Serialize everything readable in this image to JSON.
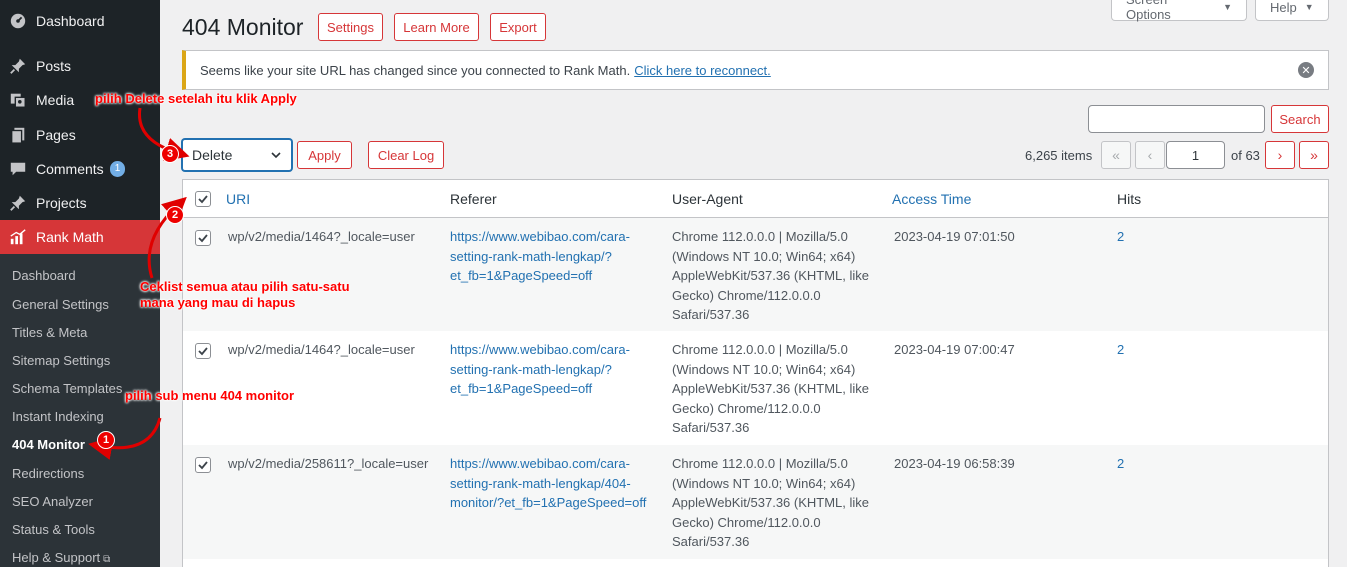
{
  "sidebar": {
    "top_items": [
      {
        "label": "Dashboard",
        "icon": "dashboard-icon"
      },
      {
        "label": "Posts",
        "icon": "pin-icon"
      },
      {
        "label": "Media",
        "icon": "media-icon"
      },
      {
        "label": "Pages",
        "icon": "pages-icon"
      },
      {
        "label": "Comments",
        "icon": "comment-icon",
        "badge": "1"
      },
      {
        "label": "Projects",
        "icon": "pin-icon"
      },
      {
        "label": "Rank Math",
        "icon": "chart-icon"
      }
    ],
    "sub_items": [
      {
        "label": "Dashboard"
      },
      {
        "label": "General Settings"
      },
      {
        "label": "Titles & Meta"
      },
      {
        "label": "Sitemap Settings"
      },
      {
        "label": "Schema Templates"
      },
      {
        "label": "Instant Indexing"
      },
      {
        "label": "404 Monitor"
      },
      {
        "label": "Redirections"
      },
      {
        "label": "SEO Analyzer"
      },
      {
        "label": "Status & Tools"
      },
      {
        "label": "Help & Support"
      }
    ]
  },
  "header": {
    "title": "404 Monitor",
    "buttons": {
      "settings": "Settings",
      "learn_more": "Learn More",
      "export": "Export"
    },
    "screen_options": "Screen Options",
    "help": "Help"
  },
  "notice": {
    "text": "Seems like your site URL has changed since you connected to Rank Math.",
    "link": "Click here to reconnect."
  },
  "toolbar": {
    "search_button": "Search",
    "bulk_action": "Delete",
    "apply": "Apply",
    "clear_log": "Clear Log",
    "items_count": "6,265 items",
    "first": "«",
    "prev": "‹",
    "current_page": "1",
    "of_pages": "of 63",
    "next": "›",
    "last": "»"
  },
  "table": {
    "headers": {
      "uri": "URI",
      "referer": "Referer",
      "user_agent": "User-Agent",
      "access_time": "Access Time",
      "hits": "Hits"
    },
    "rows": [
      {
        "uri": "wp/v2/media/1464?_locale=user",
        "referer": [
          "https://www.webibao.com/cara-",
          "setting-rank-math-lengkap/?",
          "et_fb=1&PageSpeed=off"
        ],
        "user_agent": [
          "Chrome 112.0.0.0 | Mozilla/5.0",
          "(Windows NT 10.0; Win64; x64)",
          "AppleWebKit/537.36 (KHTML, like",
          "Gecko) Chrome/112.0.0.0",
          "Safari/537.36"
        ],
        "access_time": "2023-04-19 07:01:50",
        "hits": "2"
      },
      {
        "uri": "wp/v2/media/1464?_locale=user",
        "referer": [
          "https://www.webibao.com/cara-",
          "setting-rank-math-lengkap/?",
          "et_fb=1&PageSpeed=off"
        ],
        "user_agent": [
          "Chrome 112.0.0.0 | Mozilla/5.0",
          "(Windows NT 10.0; Win64; x64)",
          "AppleWebKit/537.36 (KHTML, like",
          "Gecko) Chrome/112.0.0.0",
          "Safari/537.36"
        ],
        "access_time": "2023-04-19 07:00:47",
        "hits": "2"
      },
      {
        "uri": "wp/v2/media/258611?_locale=user",
        "referer": [
          "https://www.webibao.com/cara-",
          "setting-rank-math-lengkap/404-",
          "monitor/?et_fb=1&PageSpeed=off"
        ],
        "user_agent": [
          "Chrome 112.0.0.0 | Mozilla/5.0",
          "(Windows NT 10.0; Win64; x64)",
          "AppleWebKit/537.36 (KHTML, like",
          "Gecko) Chrome/112.0.0.0",
          "Safari/537.36"
        ],
        "access_time": "2023-04-19 06:58:39",
        "hits": "2"
      }
    ]
  },
  "annotations": {
    "step1_text": "pilih sub menu 404 monitor",
    "step1_num": "1",
    "step2_text_line1": "Ceklist semua atau pilih satu-satu",
    "step2_text_line2": "mana yang mau di hapus",
    "step2_num": "2",
    "step3_text": "pilih Delete setelah itu klik Apply",
    "step3_num": "3"
  },
  "colors": {
    "accent": "#d63638",
    "sidebar_bg": "#1d2327",
    "link": "#2271b1",
    "annotation": "#ff0000"
  }
}
